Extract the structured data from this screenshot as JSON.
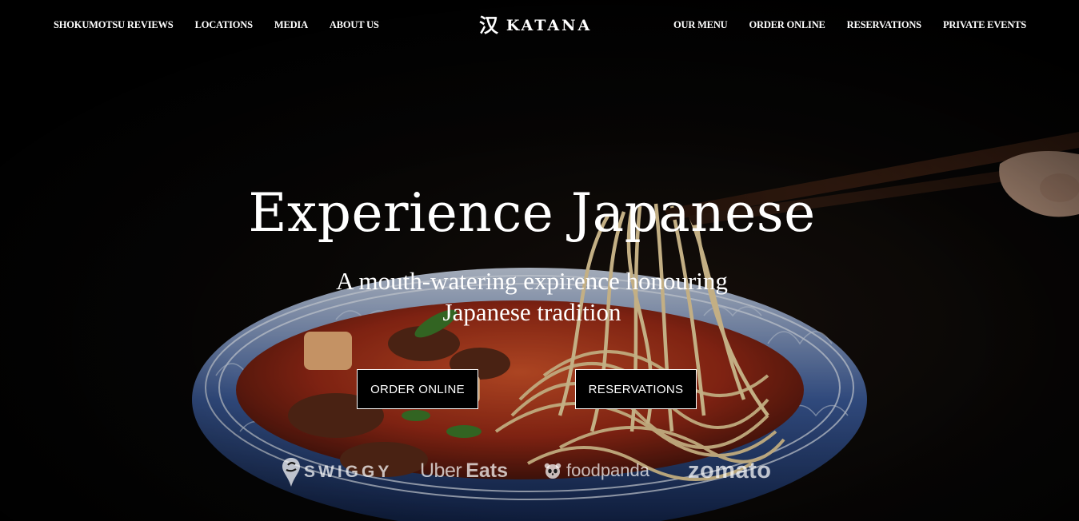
{
  "brand": {
    "mark": "汉",
    "name": "KATANA"
  },
  "nav": {
    "left": [
      {
        "label": "SHOKUMOTSU REVIEWS"
      },
      {
        "label": "LOCATIONS"
      },
      {
        "label": "MEDIA"
      },
      {
        "label": "ABOUT US"
      }
    ],
    "right": [
      {
        "label": "OUR MENU"
      },
      {
        "label": "ORDER ONLINE"
      },
      {
        "label": "RESERVATIONS"
      },
      {
        "label": "PRIVATE EVENTS"
      }
    ]
  },
  "hero": {
    "title": "Experience Japanese",
    "subtitle_line1": "A mouth-watering expirence honouring",
    "subtitle_line2": "Japanese tradition",
    "buttons": {
      "order": "ORDER ONLINE",
      "reservations": "RESERVATIONS"
    },
    "image": {
      "icon": "noodle-bowl-photo"
    }
  },
  "partners": {
    "swiggy": "SWIGGY",
    "uber_1": "Uber",
    "uber_2": "Eats",
    "foodpanda": "foodpanda",
    "zomato": "zomato"
  },
  "colors": {
    "background": "#050505",
    "text": "#ffffff",
    "button_bg": "#000000",
    "bowl_blue": "#1d3d7a",
    "noodle": "#e9c98a",
    "broth": "#b8371c"
  }
}
